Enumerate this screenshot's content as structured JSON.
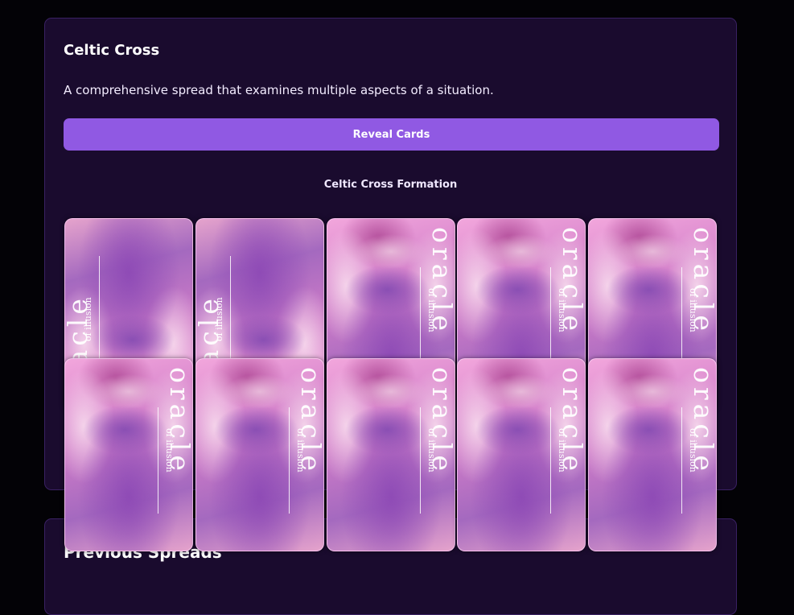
{
  "spread": {
    "title": "Celtic Cross",
    "description": "A comprehensive spread that examines multiple aspects of a situation.",
    "reveal_label": "Reveal Cards",
    "formation_title": "Celtic Cross Formation"
  },
  "cards": [
    {
      "orientation": "reversed",
      "brand": "oracle",
      "tagline": "of illusion"
    },
    {
      "orientation": "reversed",
      "brand": "oracle",
      "tagline": "of illusion"
    },
    {
      "orientation": "upright",
      "brand": "oracle",
      "tagline": "of illusion"
    },
    {
      "orientation": "upright",
      "brand": "oracle",
      "tagline": "of illusion"
    },
    {
      "orientation": "upright",
      "brand": "oracle",
      "tagline": "of illusion"
    },
    {
      "orientation": "upright",
      "brand": "oracle",
      "tagline": "of illusion"
    },
    {
      "orientation": "upright",
      "brand": "oracle",
      "tagline": "of illusion"
    },
    {
      "orientation": "upright",
      "brand": "oracle",
      "tagline": "of illusion"
    },
    {
      "orientation": "upright",
      "brand": "oracle",
      "tagline": "of illusion"
    },
    {
      "orientation": "upright",
      "brand": "oracle",
      "tagline": "of illusion"
    }
  ],
  "previous": {
    "title": "Previous Spreads"
  },
  "colors": {
    "background": "#030206",
    "panel": "#1a0b2e",
    "accent": "#9059e3"
  }
}
